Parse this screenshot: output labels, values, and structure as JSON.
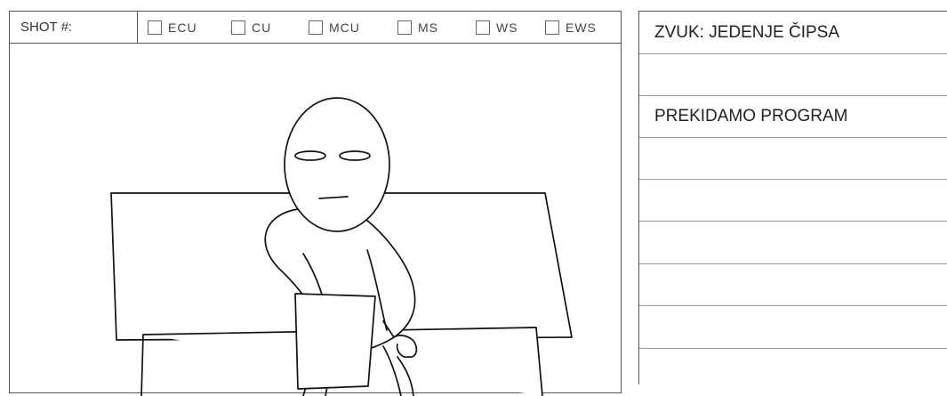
{
  "shot": {
    "label": "SHOT #:",
    "options": [
      "ECU",
      "CU",
      "MCU",
      "MS",
      "WS",
      "EWS"
    ]
  },
  "notes": {
    "lines": [
      "ZVUK: JEDENJE ČIPSA",
      "",
      "PREKIDAMO PROGRAM",
      "",
      "",
      "",
      "",
      "",
      ""
    ]
  }
}
